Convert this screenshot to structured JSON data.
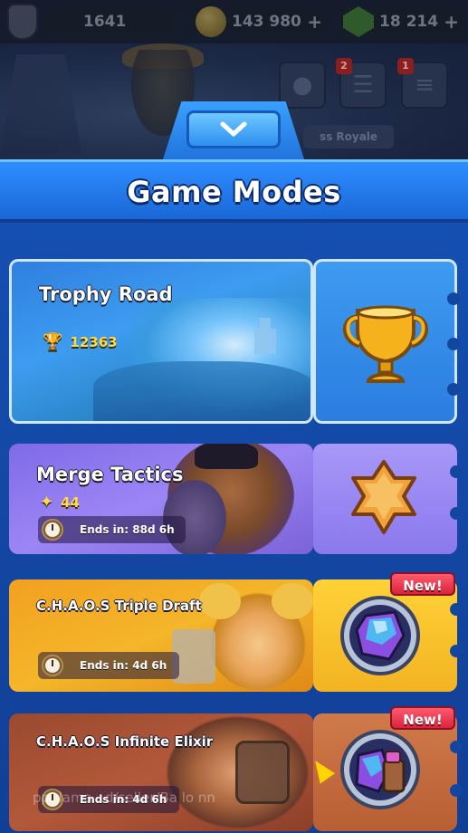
{
  "header": {
    "trophies": "1641",
    "gold": "143 980",
    "gems": "18 214",
    "friends_badge": "2",
    "news_badge": "1",
    "battle_label": "ss Royale"
  },
  "panel": {
    "title": "Game Modes"
  },
  "modes": [
    {
      "title": "Trophy Road",
      "value": "12363",
      "value_icon": "trophy-icon",
      "stub_icon": "trophy-cup-icon"
    },
    {
      "title": "Merge Tactics",
      "value": "44",
      "value_icon": "sparkle-icon",
      "timer": "Ends in: 88d 6h",
      "stub_icon": "star-icon"
    },
    {
      "title": "C.H.A.O.S Triple Draft",
      "timer": "Ends in: 4d 6h",
      "badge": "New!",
      "stub_icon": "chaos-crystal-icon"
    },
    {
      "title": "C.H.A.O.S Infinite Elixir",
      "timer": "Ends in: 4d 6h",
      "badge": "New!",
      "stub_icon": "chaos-elixir-icon"
    }
  ],
  "watermark": "pp.   lama   ..d/seller/Ba  lo  nn",
  "colors": {
    "panel_blue": "#154fb0",
    "title_bar": "#2f8eff",
    "trophy_road": "#3d9cf0",
    "merge_tactics": "#9c86f5",
    "chaos_draft": "#f4b62a",
    "chaos_elixir": "#b3583a",
    "new_badge": "#d9243c",
    "gold_text": "#ffd94a"
  }
}
